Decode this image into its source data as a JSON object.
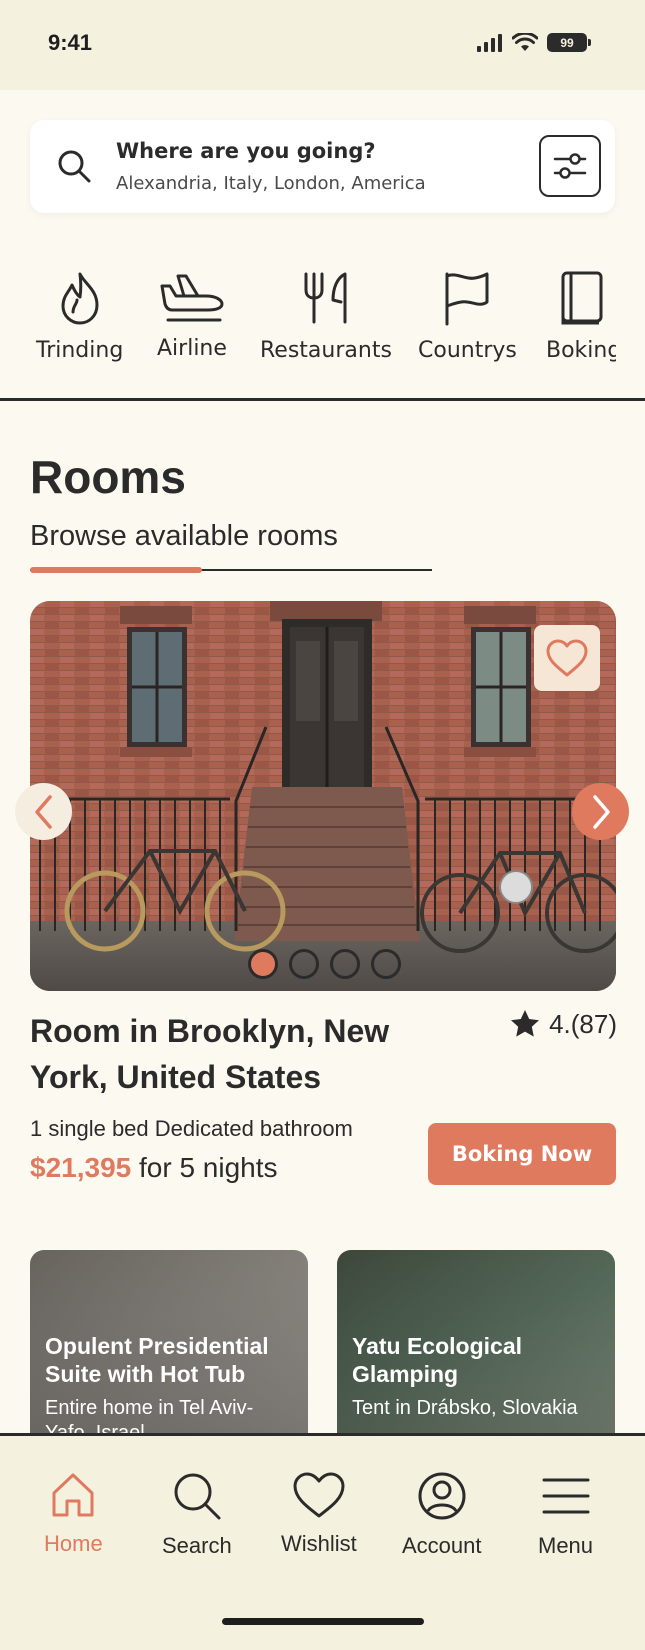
{
  "status_bar": {
    "time": "9:41",
    "battery": "99"
  },
  "search": {
    "title": "Where are you going?",
    "subtitle": "Alexandria, Italy, London, America"
  },
  "categories": [
    {
      "label": "Trinding",
      "icon": "flame-icon"
    },
    {
      "label": "Airline",
      "icon": "airplane-icon"
    },
    {
      "label": "Restaurants",
      "icon": "fork-knife-icon"
    },
    {
      "label": "Countrys",
      "icon": "flag-icon"
    },
    {
      "label": "Boking",
      "icon": "book-icon"
    }
  ],
  "rooms": {
    "title": "Rooms",
    "subtitle": "Browse available rooms"
  },
  "carousel": {
    "slides": 4,
    "active_index": 0
  },
  "featured_room": {
    "name": "Room in Brooklyn, New York, United States",
    "rating": "4.(87)",
    "features": "1 single bed Dedicated bathroom",
    "price": "$21,395",
    "price_suffix": "for 5 nights",
    "book_label": "Boking Now"
  },
  "listings": [
    {
      "title": "Opulent Presidential Suite with Hot Tub",
      "subtitle": "Entire home in Tel Aviv-Yafo, Israel"
    },
    {
      "title": "Yatu Ecological Glamping",
      "subtitle": "Tent in Drábsko, Slovakia"
    }
  ],
  "bottom_nav": [
    {
      "label": "Home",
      "icon": "home-icon",
      "active": true
    },
    {
      "label": "Search",
      "icon": "search-icon",
      "active": false
    },
    {
      "label": "Wishlist",
      "icon": "heart-icon",
      "active": false
    },
    {
      "label": "Account",
      "icon": "account-icon",
      "active": false
    },
    {
      "label": "Menu",
      "icon": "menu-icon",
      "active": false
    }
  ],
  "colors": {
    "accent": "#E07A5F",
    "background": "#FCFAF0",
    "surface": "#F5F1DF",
    "text": "#2B2B2B"
  }
}
